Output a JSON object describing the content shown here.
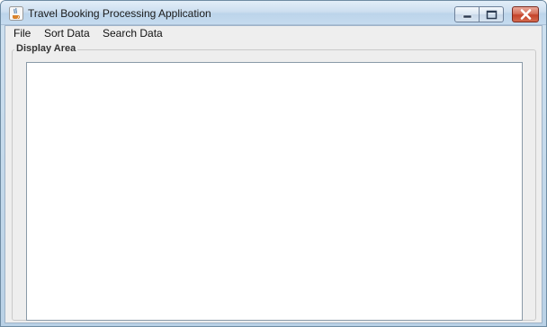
{
  "window": {
    "title": "Travel Booking Processing Application"
  },
  "menubar": {
    "items": [
      {
        "label": "File"
      },
      {
        "label": "Sort Data"
      },
      {
        "label": "Search Data"
      }
    ]
  },
  "main": {
    "group_title": "Display Area",
    "text_area_value": ""
  },
  "colors": {
    "title_bar": "#cddff0",
    "close_button": "#c4432a",
    "client_background": "#eeeeee",
    "display_background": "#ffffff"
  },
  "icons": {
    "app": "java-coffee-cup-icon",
    "minimize": "minimize-icon",
    "maximize": "maximize-icon",
    "close": "close-icon"
  }
}
